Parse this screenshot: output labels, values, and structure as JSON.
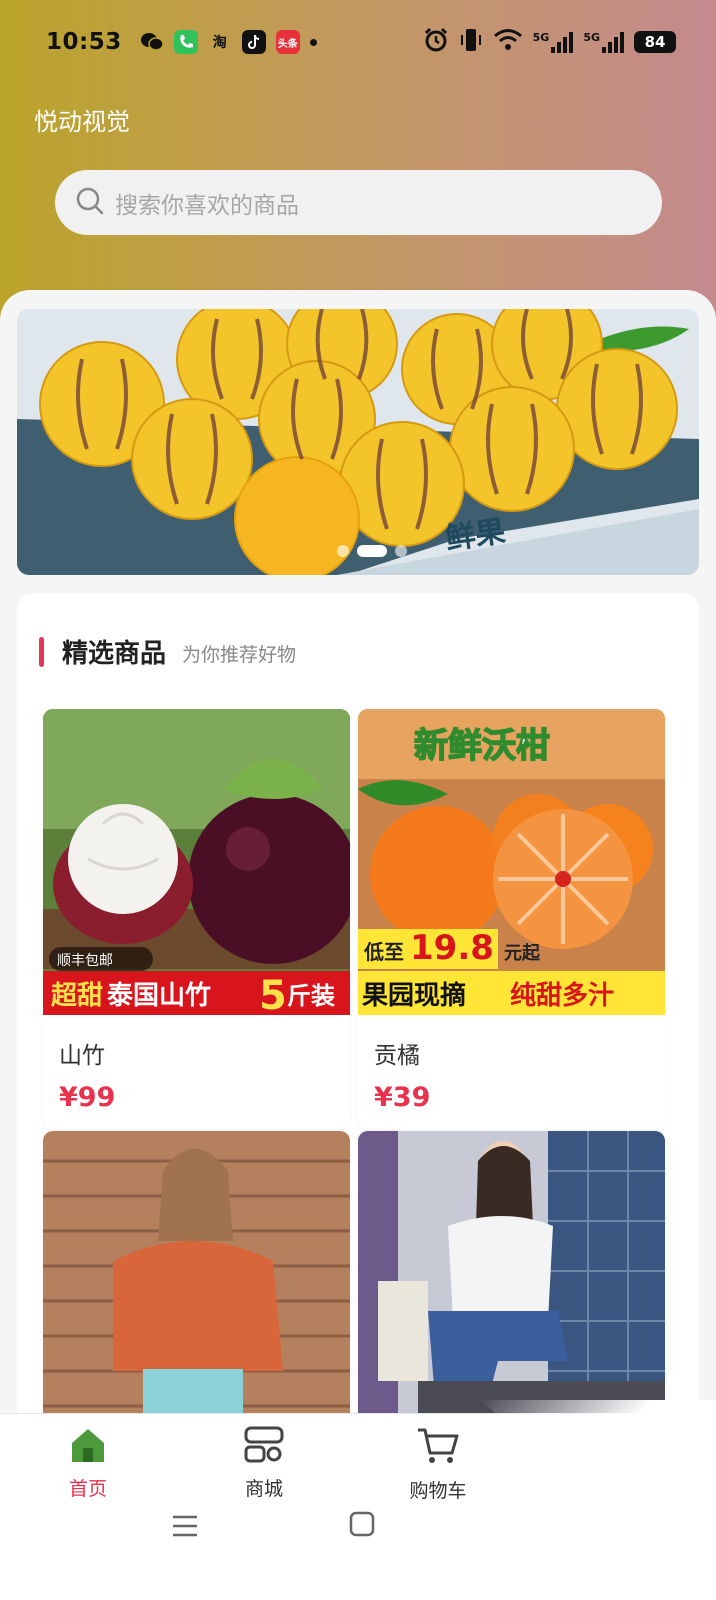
{
  "status_bar": {
    "time": "10:53",
    "apps": [
      "wechat-icon",
      "phone-icon",
      "taobao-icon",
      "tiktok-icon",
      "toutiao-icon"
    ],
    "taobao_char": "淘",
    "toutiao_char": "头条",
    "network": [
      "5G",
      "5G"
    ],
    "battery": "84"
  },
  "header": {
    "app_name": "悦动视觉",
    "search_placeholder": "搜索你喜欢的商品"
  },
  "banner": {
    "product_text": "鲜果",
    "slide_count": 3,
    "active_slide": 1
  },
  "section": {
    "title": "精选商品",
    "subtitle": "为你推荐好物"
  },
  "products": [
    {
      "name": "山竹",
      "price": "¥99",
      "image_texts": {
        "badge": "顺丰包邮",
        "ribbon_a": "超甜",
        "ribbon_b": "泰国山竹",
        "ribbon_c": "5",
        "ribbon_d": "斤装"
      }
    },
    {
      "name": "贡橘",
      "price": "¥39",
      "image_texts": {
        "top": "新鲜沃柑",
        "promo_a": "低至",
        "promo_b": "19.8",
        "promo_c": "元起",
        "ribbon_a": "果园现摘",
        "ribbon_b": "纯甜多汁"
      }
    },
    {
      "name": "",
      "price": "",
      "image_texts": {}
    },
    {
      "name": "",
      "price": "",
      "image_texts": {}
    }
  ],
  "tabbar": {
    "items": [
      {
        "label": "首页",
        "icon": "home-icon",
        "active": true
      },
      {
        "label": "商城",
        "icon": "store-icon",
        "active": false
      },
      {
        "label": "购物车",
        "icon": "cart-icon",
        "active": false
      }
    ]
  },
  "colors": {
    "accent": "#e8324e",
    "header_start": "#bba42a",
    "header_end": "#c48a8e"
  }
}
